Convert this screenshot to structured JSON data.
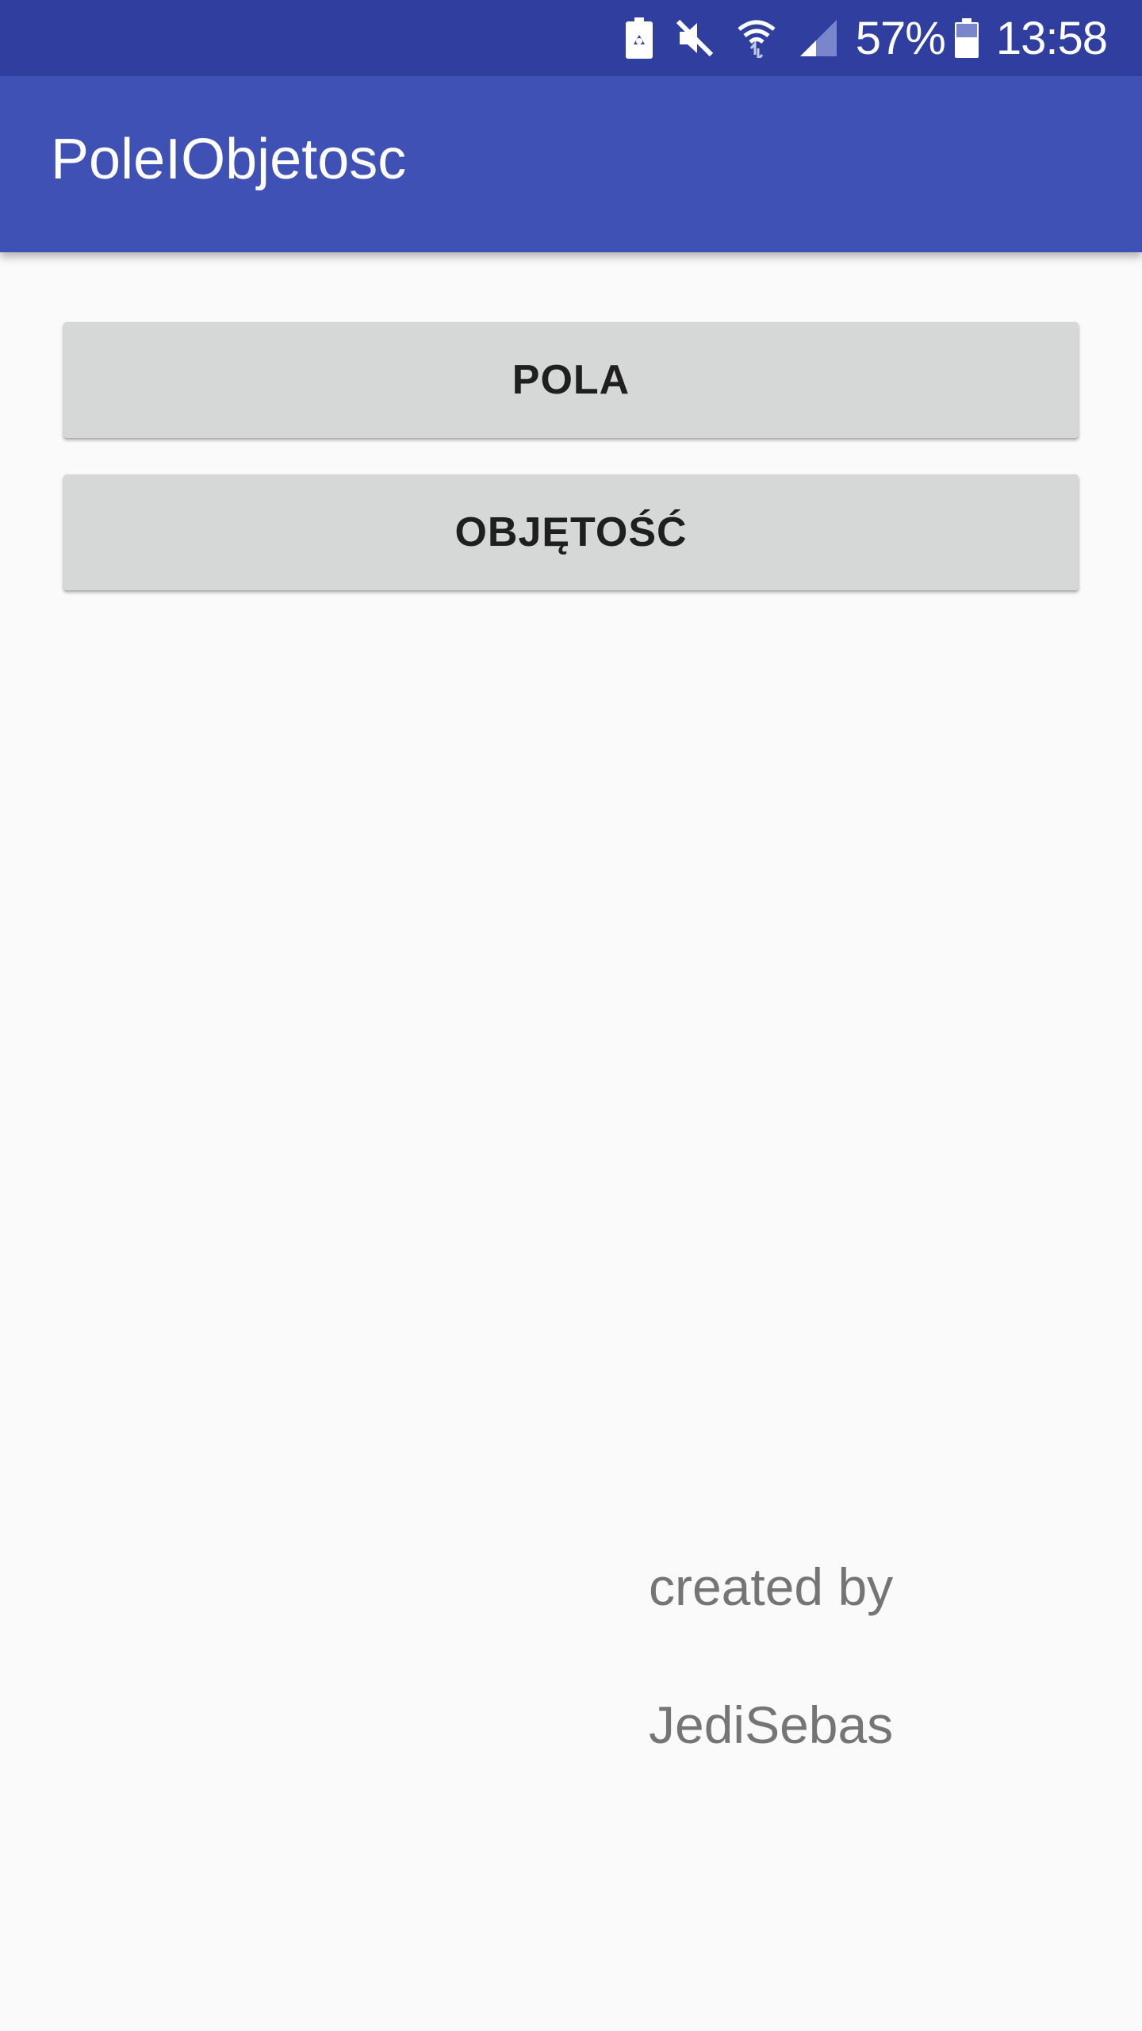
{
  "status_bar": {
    "battery_percent": "57%",
    "time": "13:58",
    "icons": [
      "battery-saver-icon",
      "mute-icon",
      "wifi-icon",
      "signal-icon",
      "battery-icon"
    ],
    "color": "#303f9f"
  },
  "app_bar": {
    "title": "PoleIObjetosc",
    "color": "#3f51b5"
  },
  "buttons": {
    "pola_label": "POLA",
    "objetosc_label": "OBJĘTOŚĆ"
  },
  "credit": {
    "line1": "created by",
    "line2": "JediSebas"
  }
}
